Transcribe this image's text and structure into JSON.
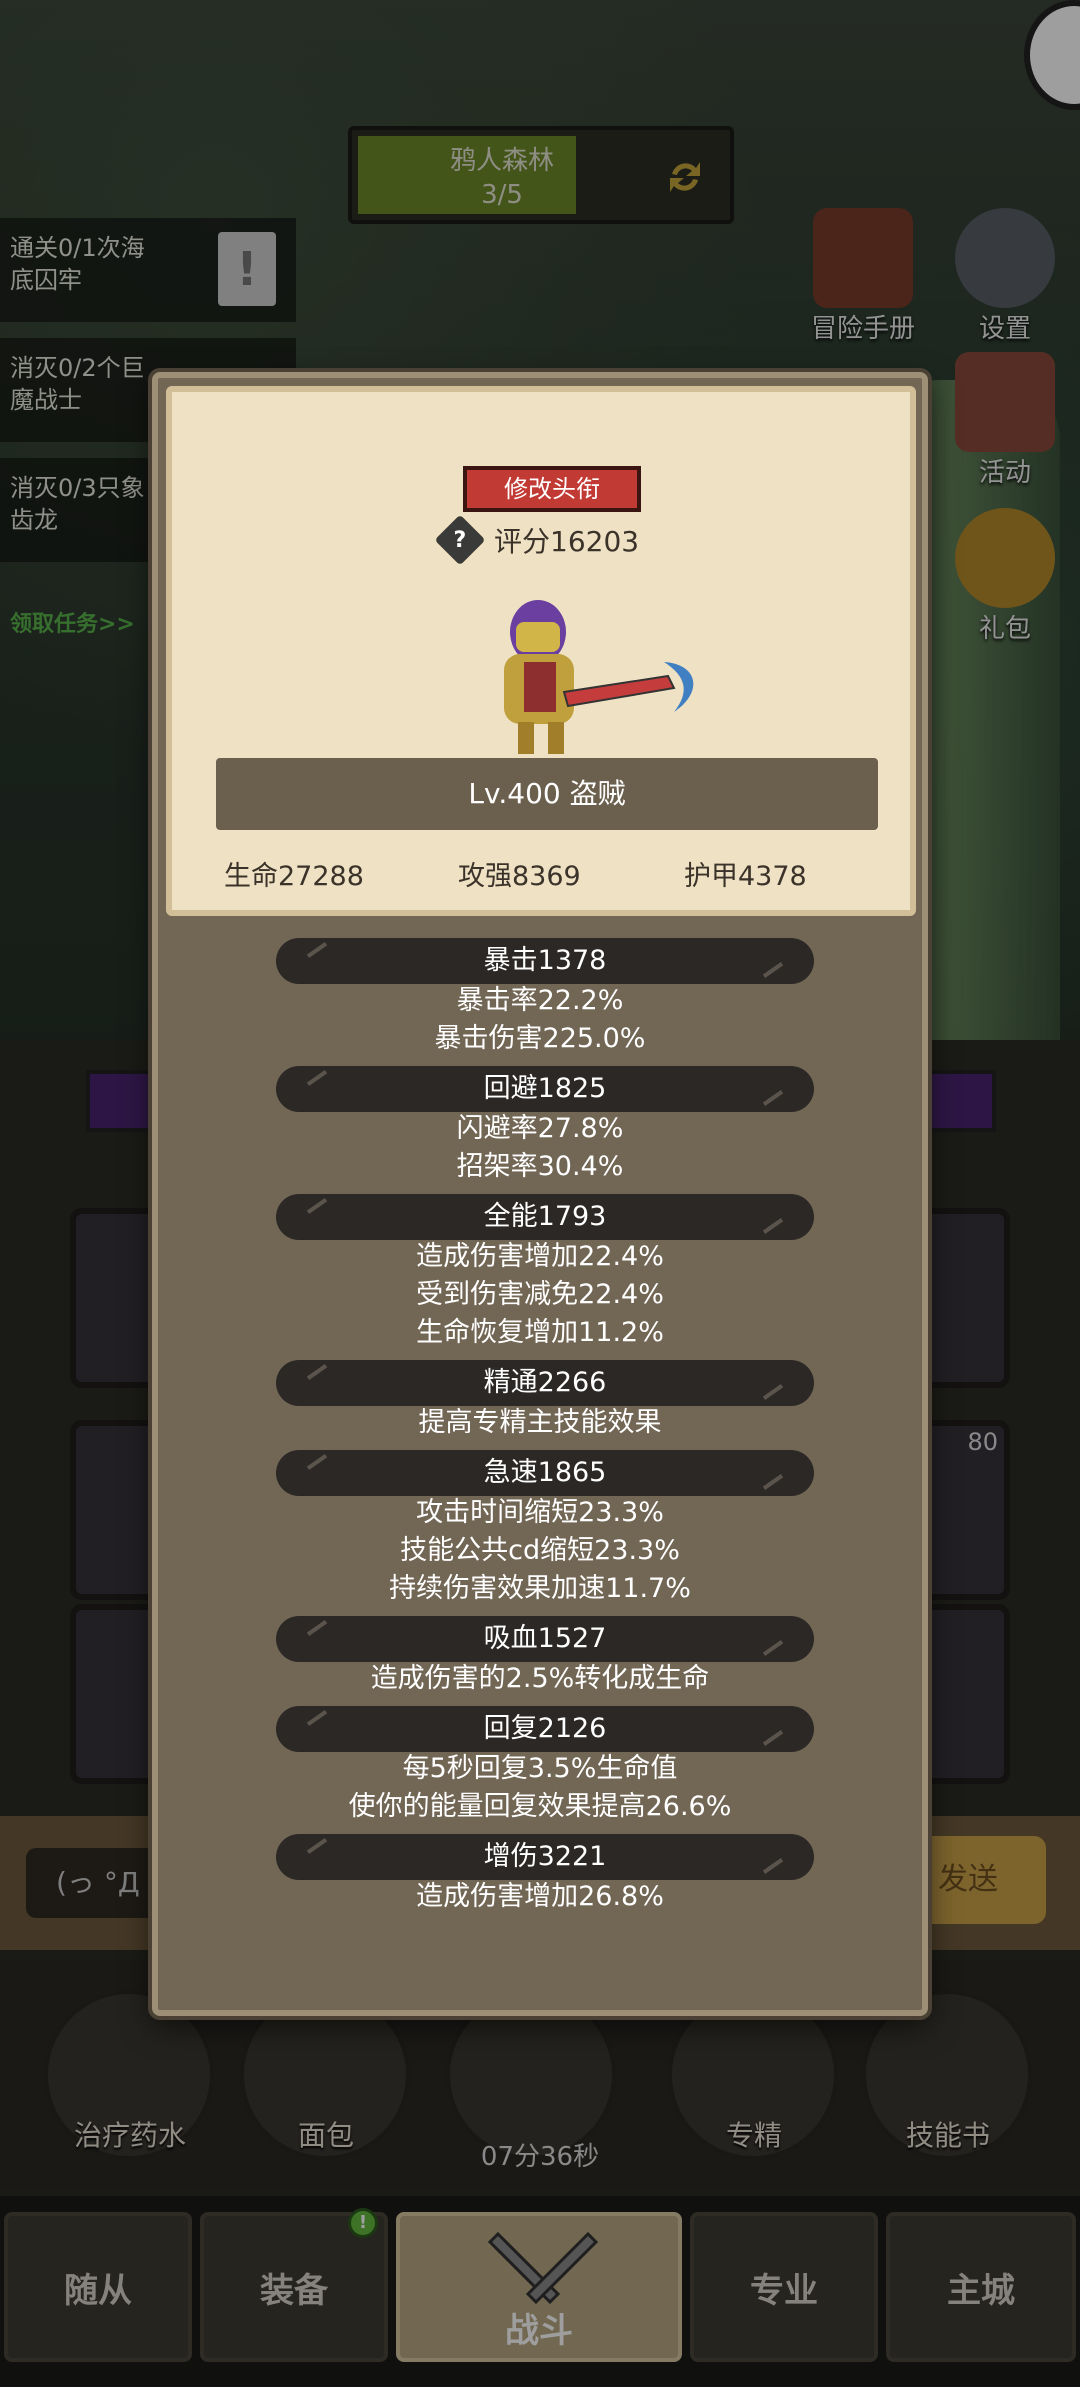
{
  "stage": {
    "name": "鸦人森林",
    "progress": "3/5",
    "progress_fraction": 0.6
  },
  "quests": [
    {
      "text_line1": "通关0/1次海",
      "text_line2": "底囚牢"
    },
    {
      "text_line1": "消灭0/2个巨",
      "text_line2": "魔战士"
    },
    {
      "text_line1": "消灭0/3只象",
      "text_line2": "齿龙"
    }
  ],
  "quest_link": "领取任务>>",
  "side_menu": [
    {
      "label": "冒险手册",
      "icon": "book-icon"
    },
    {
      "label": "设置",
      "icon": "gear-icon"
    },
    {
      "label": "活动",
      "icon": "scroll-icon"
    },
    {
      "label": "礼包",
      "icon": "gift-icon"
    }
  ],
  "slot_badge": "80",
  "chat": {
    "placeholder": "(っ °Д °",
    "send": "发送"
  },
  "items": [
    {
      "label": "治疗药水",
      "icon": "potion-icon"
    },
    {
      "label": "面包",
      "icon": "bread-icon"
    },
    {
      "label": "",
      "icon": "chest-icon"
    },
    {
      "label": "专精",
      "icon": "spec-icon"
    },
    {
      "label": "技能书",
      "icon": "skillbook-icon"
    }
  ],
  "timer": "07分36秒",
  "nav": {
    "tabs": [
      "随从",
      "装备",
      "战斗",
      "专业",
      "主城"
    ],
    "active": "战斗",
    "badge": "!"
  },
  "profile": {
    "edit_title": "修改头衔",
    "score": "评分16203",
    "level_class": "Lv.400 盗贼",
    "hp": "生命27288",
    "attack": "攻强8369",
    "armor": "护甲4378"
  },
  "attributes": [
    {
      "header": "暴击1378",
      "lines": [
        "暴击率22.2%",
        "暴击伤害225.0%"
      ]
    },
    {
      "header": "回避1825",
      "lines": [
        "闪避率27.8%",
        "招架率30.4%"
      ]
    },
    {
      "header": "全能1793",
      "lines": [
        "造成伤害增加22.4%",
        "受到伤害减免22.4%",
        "生命恢复增加11.2%"
      ]
    },
    {
      "header": "精通2266",
      "lines": [
        "提高专精主技能效果"
      ]
    },
    {
      "header": "急速1865",
      "lines": [
        "攻击时间缩短23.3%",
        "技能公共cd缩短23.3%",
        "持续伤害效果加速11.7%"
      ]
    },
    {
      "header": "吸血1527",
      "lines": [
        "造成伤害的2.5%转化成生命"
      ]
    },
    {
      "header": "回复2126",
      "lines": [
        "每5秒回复3.5%生命值",
        "使你的能量回复效果提高26.6%"
      ]
    },
    {
      "header": "增伤3221",
      "lines": [
        "造成伤害增加26.8%"
      ]
    }
  ],
  "colors": {
    "modal_bg": "#726655",
    "card_bg": "#efe2c4",
    "edit_button": "#c23a34",
    "header_pill": "#2b2825"
  }
}
